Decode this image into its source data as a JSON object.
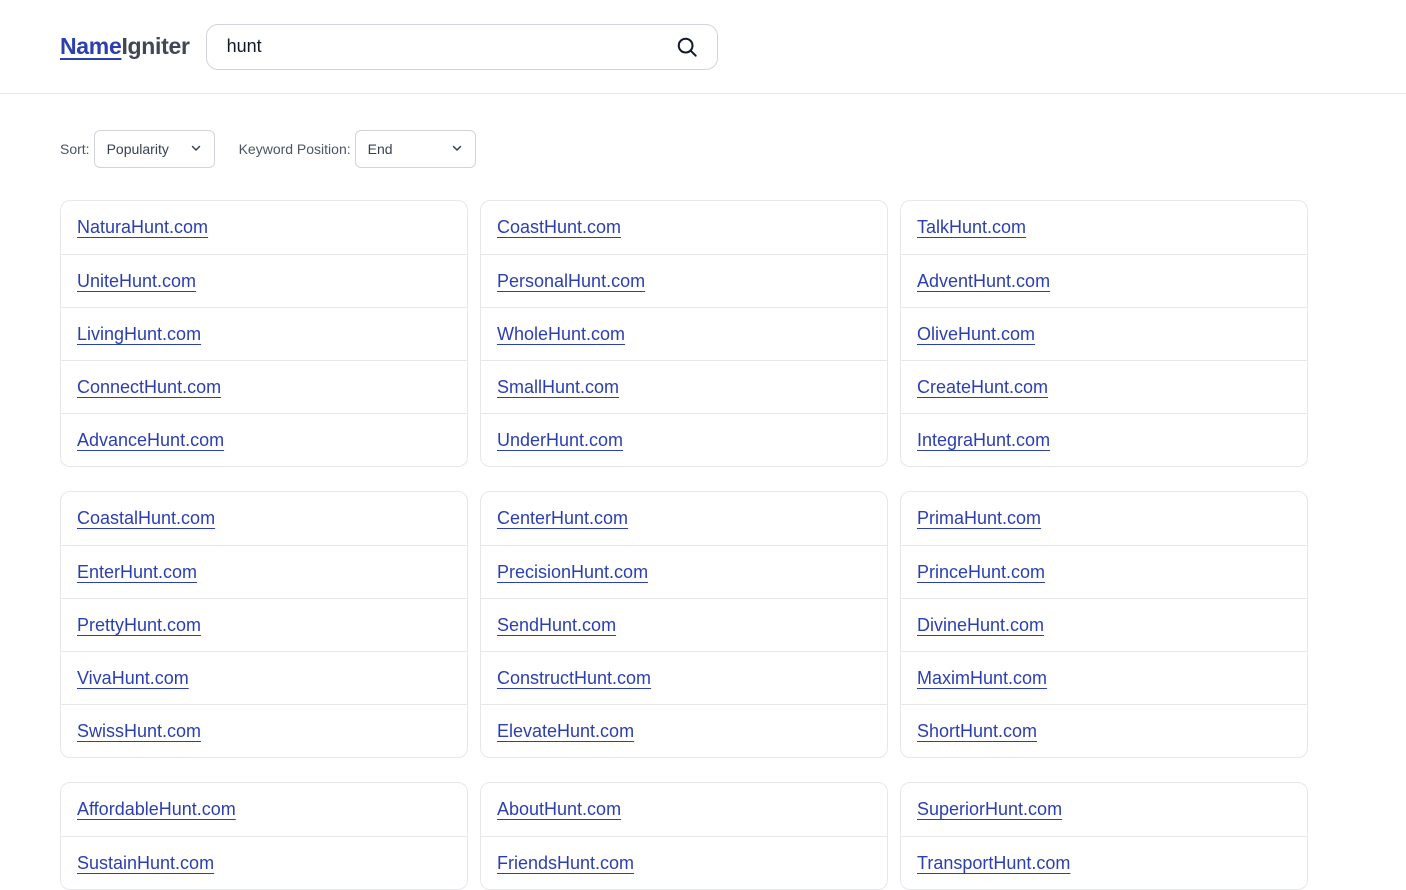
{
  "logo": {
    "part1": "Name",
    "part2": "Igniter"
  },
  "search": {
    "value": "hunt"
  },
  "filters": {
    "sort_label": "Sort:",
    "sort_value": "Popularity",
    "position_label": "Keyword Position:",
    "position_value": "End"
  },
  "cards": [
    [
      "NaturaHunt.com",
      "UniteHunt.com",
      "LivingHunt.com",
      "ConnectHunt.com",
      "AdvanceHunt.com"
    ],
    [
      "CoastHunt.com",
      "PersonalHunt.com",
      "WholeHunt.com",
      "SmallHunt.com",
      "UnderHunt.com"
    ],
    [
      "TalkHunt.com",
      "AdventHunt.com",
      "OliveHunt.com",
      "CreateHunt.com",
      "IntegraHunt.com"
    ],
    [
      "CoastalHunt.com",
      "EnterHunt.com",
      "PrettyHunt.com",
      "VivaHunt.com",
      "SwissHunt.com"
    ],
    [
      "CenterHunt.com",
      "PrecisionHunt.com",
      "SendHunt.com",
      "ConstructHunt.com",
      "ElevateHunt.com"
    ],
    [
      "PrimaHunt.com",
      "PrinceHunt.com",
      "DivineHunt.com",
      "MaximHunt.com",
      "ShortHunt.com"
    ],
    [
      "AffordableHunt.com",
      "SustainHunt.com"
    ],
    [
      "AboutHunt.com",
      "FriendsHunt.com"
    ],
    [
      "SuperiorHunt.com",
      "TransportHunt.com"
    ]
  ]
}
